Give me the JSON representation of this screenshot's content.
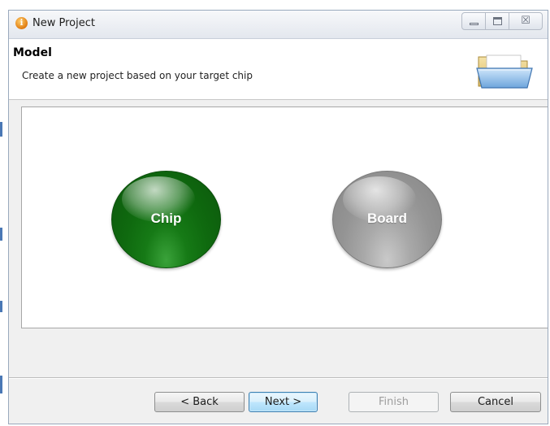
{
  "window": {
    "title": "New Project",
    "title_icon": "info-icon",
    "controls": {
      "minimize_icon": "minimize-icon",
      "maximize_icon": "maximize-icon",
      "close_icon": "close-icon",
      "close_glyph": "☒"
    }
  },
  "header": {
    "title": "Model",
    "description": "Create a new project based on your target chip",
    "icon": "folder-icon"
  },
  "options": [
    {
      "label": "Chip",
      "color": "#127012",
      "selected": true
    },
    {
      "label": "Board",
      "color": "#999999",
      "selected": false
    }
  ],
  "buttons": {
    "back": "< Back",
    "next": "Next >",
    "finish": "Finish",
    "cancel": "Cancel"
  },
  "colors": {
    "accent": "#3c7fb1",
    "chip_green": "#127012",
    "board_gray": "#999999"
  }
}
